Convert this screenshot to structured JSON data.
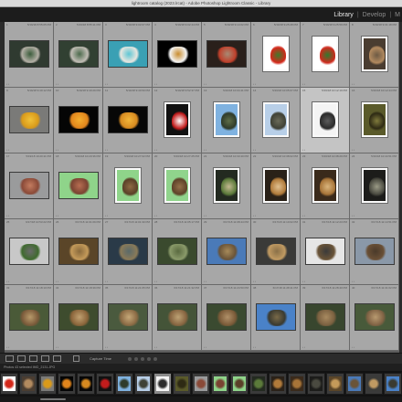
{
  "window": {
    "title": "lightroom catalog (2023.lrcat) - Adobe Photoshop Lightroom Classic - Library"
  },
  "modules": {
    "library": "Library",
    "develop": "Develop",
    "map": "M",
    "separator": "|"
  },
  "toolbar": {
    "label": "Capture Time"
  },
  "filmstrip": {
    "source": "Photos  43 selected  IMG_2131.JPG"
  },
  "colors": {
    "grid_cell": "#a7a7a7",
    "grid_cell_selected": "#c4c4c4",
    "grid_bg": "#5e5e5e",
    "active_module": "#e8e8e8"
  },
  "photos": [
    {
      "idx": "1",
      "date": "5/19/18 8:55:05 PM",
      "colors": [
        "#2f3a30",
        "#b4b0a6",
        "#3b5c3b"
      ],
      "subject": "people-on-bench"
    },
    {
      "idx": "2",
      "date": "5/19/18 8:55:11 PM",
      "colors": [
        "#314032",
        "#c2beb6",
        "#4c6a4c"
      ],
      "subject": "people-on-bench"
    },
    {
      "idx": "3",
      "date": "5/19/18 9:02:07 PM",
      "colors": [
        "#3aa0b4",
        "#e8e6df",
        "#5ec6d4"
      ],
      "subject": "bird"
    },
    {
      "idx": "4",
      "date": "5/19/18 9:02:44 PM",
      "colors": [
        "#000000",
        "#f3f3f3",
        "#c98c2e"
      ],
      "subject": "eagle"
    },
    {
      "idx": "5",
      "date": "5/19/18 9:14:02 PM",
      "colors": [
        "#2a201b",
        "#c0402b",
        "#a78a74"
      ],
      "subject": "hand"
    },
    {
      "idx": "6",
      "date": "5/19/18 9:25:28 PM",
      "colors": [
        "#ffffff",
        "#d4281a",
        "#3f7a2c"
      ],
      "subject": "tomato"
    },
    {
      "idx": "7",
      "date": "5/19/18 9:25:59 PM",
      "colors": [
        "#ffffff",
        "#cf2a1d",
        "#2f7a2e"
      ],
      "subject": "tomato"
    },
    {
      "idx": "8",
      "date": "5/19/18 9:31:18 PM",
      "colors": [
        "#4a3d31",
        "#b28a5f",
        "#6d5a44"
      ],
      "subject": "lynx"
    },
    {
      "idx": "9",
      "date": "5/19/18 9:40:12 PM",
      "colors": [
        "#7a7a78",
        "#d99a1a",
        "#f0c23a"
      ],
      "subject": "flower"
    },
    {
      "idx": "10",
      "date": "5/19/18 9:40:29 PM",
      "colors": [
        "#050505",
        "#e1851c",
        "#f3ae2f"
      ],
      "subject": "flower"
    },
    {
      "idx": "11",
      "date": "5/19/18 9:40:50 PM",
      "colors": [
        "#070707",
        "#d78a20",
        "#f2b63a"
      ],
      "subject": "flower"
    },
    {
      "idx": "12",
      "date": "5/19/18 9:52:37 PM",
      "colors": [
        "#111111",
        "#c21c1c",
        "#ffffff"
      ],
      "subject": "gasoline-sign"
    },
    {
      "idx": "13",
      "date": "5/19/18 10:04:41 PM",
      "colors": [
        "#7fb2e0",
        "#2f3b2a",
        "#5e6d48"
      ],
      "subject": "statue"
    },
    {
      "idx": "14",
      "date": "5/19/18 10:05:07 PM",
      "colors": [
        "#b8cfe8",
        "#3f4135",
        "#6a6a58"
      ],
      "subject": "statue"
    },
    {
      "idx": "15",
      "date": "5/19/18 10:12:19 PM",
      "colors": [
        "#f4f4f4",
        "#2a2a2a",
        "#5b5b5b"
      ],
      "subject": "gorilla"
    },
    {
      "idx": "16",
      "date": "5/19/18 10:12:44 PM",
      "colors": [
        "#5a5a2a",
        "#2e2a14",
        "#7f7a3c"
      ],
      "subject": "gorilla"
    },
    {
      "idx": "17",
      "date": "5/19/18 10:20:11 PM",
      "colors": [
        "#9a9b9c",
        "#8a4a38",
        "#c47c60"
      ],
      "subject": "animal"
    },
    {
      "idx": "18",
      "date": "5/19/18 10:20:36 PM",
      "colors": [
        "#8fd48a",
        "#7a4332",
        "#b86e52"
      ],
      "subject": "animal"
    },
    {
      "idx": "19",
      "date": "5/19/18 10:27:02 PM",
      "colors": [
        "#8fd48a",
        "#5a4028",
        "#8e6a44"
      ],
      "subject": "hedgehog"
    },
    {
      "idx": "20",
      "date": "5/19/18 10:27:25 PM",
      "colors": [
        "#90d48c",
        "#5e4229",
        "#94704a"
      ],
      "subject": "hedgehog"
    },
    {
      "idx": "21",
      "date": "5/19/18 10:33:40 PM",
      "colors": [
        "#232a20",
        "#5b7a3a",
        "#c3b890"
      ],
      "subject": "building"
    },
    {
      "idx": "22",
      "date": "5/19/18 10:38:02 PM",
      "colors": [
        "#2a2118",
        "#b07a3a",
        "#e0c090"
      ],
      "subject": "tiger"
    },
    {
      "idx": "23",
      "date": "5/19/18 10:38:29 PM",
      "colors": [
        "#3a2a1b",
        "#a77438",
        "#d9b47c"
      ],
      "subject": "tiger"
    },
    {
      "idx": "24",
      "date": "5/19/18 10:44:51 PM",
      "colors": [
        "#1c1c1a",
        "#4a4a40",
        "#9a9a86"
      ],
      "subject": "gorilla"
    },
    {
      "idx": "25",
      "date": "6/17/18 10:53:22 PM",
      "colors": [
        "#c8c8c8",
        "#3f6a2e",
        "#6a6a6a"
      ],
      "subject": "house"
    },
    {
      "idx": "26",
      "date": "6/17/18 11:01:09 PM",
      "colors": [
        "#5a4528",
        "#c49a5a",
        "#8a6a3c"
      ],
      "subject": "hawk"
    },
    {
      "idx": "27",
      "date": "6/17/18 11:01:30 PM",
      "colors": [
        "#2a3a48",
        "#8a7a58",
        "#5a6a6a"
      ],
      "subject": "hawk"
    },
    {
      "idx": "28",
      "date": "6/17/18 11:05:17 PM",
      "colors": [
        "#3a4a2e",
        "#8a9a6a",
        "#5a6a40"
      ],
      "subject": "hawk"
    },
    {
      "idx": "29",
      "date": "6/17/18 11:08:44 PM",
      "colors": [
        "#4a7ab8",
        "#6a5438",
        "#a78a5a"
      ],
      "subject": "hawk"
    },
    {
      "idx": "30",
      "date": "6/17/18 11:10:02 PM",
      "colors": [
        "#3a3a38",
        "#c09a62",
        "#8a7048"
      ],
      "subject": "owl"
    },
    {
      "idx": "31",
      "date": "6/17/18 11:12:23 PM",
      "colors": [
        "#e6e6e6",
        "#6a5438",
        "#3a3a3a"
      ],
      "subject": "owl"
    },
    {
      "idx": "32",
      "date": "6/17/18 11:14:51 PM",
      "colors": [
        "#8a98a8",
        "#6a5036",
        "#4a3a2a"
      ],
      "subject": "owl"
    },
    {
      "idx": "33",
      "date": "6/17/18 11:18:10 PM",
      "colors": [
        "#4a5a38",
        "#7a5a3a",
        "#b89a6a"
      ],
      "subject": "owl"
    },
    {
      "idx": "34",
      "date": "6/17/18 11:18:39 PM",
      "colors": [
        "#3e4c2e",
        "#8a643a",
        "#c0a070"
      ],
      "subject": "owl"
    },
    {
      "idx": "35",
      "date": "6/17/18 11:21:05 PM",
      "colors": [
        "#4a5a3e",
        "#8a6a44",
        "#c6a878"
      ],
      "subject": "owl"
    },
    {
      "idx": "36",
      "date": "6/17/18 11:21:32 PM",
      "colors": [
        "#445438",
        "#866440",
        "#bda274"
      ],
      "subject": "owl"
    },
    {
      "idx": "37",
      "date": "6/17/18 11:24:50 PM",
      "colors": [
        "#3a4a30",
        "#7a5a38",
        "#b09068"
      ],
      "subject": "owl"
    },
    {
      "idx": "38",
      "date": "6/17/18 11:28:11 PM",
      "colors": [
        "#4a82c8",
        "#3a3a30",
        "#7a6a48"
      ],
      "subject": "hawk"
    },
    {
      "idx": "39",
      "date": "6/17/18 11:28:40 PM",
      "colors": [
        "#38462e",
        "#7a6040",
        "#a88a60"
      ],
      "subject": "owl"
    },
    {
      "idx": "40",
      "date": "6/17/18 11:31:02 PM",
      "colors": [
        "#485a3a",
        "#806244",
        "#b89a70"
      ],
      "subject": "owl"
    }
  ],
  "filmstrip_items": [
    {
      "colors": [
        "#ffffff",
        "#d4281a"
      ]
    },
    {
      "colors": [
        "#4a3d31",
        "#b28a5f"
      ]
    },
    {
      "colors": [
        "#7a7a78",
        "#d99a1a"
      ]
    },
    {
      "colors": [
        "#050505",
        "#e1851c"
      ]
    },
    {
      "colors": [
        "#070707",
        "#d78a20"
      ]
    },
    {
      "colors": [
        "#111111",
        "#c21c1c"
      ]
    },
    {
      "colors": [
        "#7fb2e0",
        "#2f3b2a"
      ]
    },
    {
      "colors": [
        "#b8cfe8",
        "#3f4135"
      ]
    },
    {
      "colors": [
        "#f4f4f4",
        "#2a2a2a"
      ]
    },
    {
      "colors": [
        "#5a5a2a",
        "#2e2a14"
      ]
    },
    {
      "colors": [
        "#9a9b9c",
        "#8a4a38"
      ]
    },
    {
      "colors": [
        "#8fd48a",
        "#7a4332"
      ]
    },
    {
      "colors": [
        "#8fd48a",
        "#5a4028"
      ]
    },
    {
      "colors": [
        "#232a20",
        "#5b7a3a"
      ]
    },
    {
      "colors": [
        "#2a2118",
        "#b07a3a"
      ]
    },
    {
      "colors": [
        "#3a2a1b",
        "#a77438"
      ]
    },
    {
      "colors": [
        "#1c1c1a",
        "#4a4a40"
      ]
    },
    {
      "colors": [
        "#5a4528",
        "#c49a5a"
      ]
    },
    {
      "colors": [
        "#4a7ab8",
        "#6a5438"
      ]
    },
    {
      "colors": [
        "#3a3a38",
        "#c09a62"
      ]
    },
    {
      "colors": [
        "#4a82c8",
        "#3a3a30"
      ]
    }
  ]
}
